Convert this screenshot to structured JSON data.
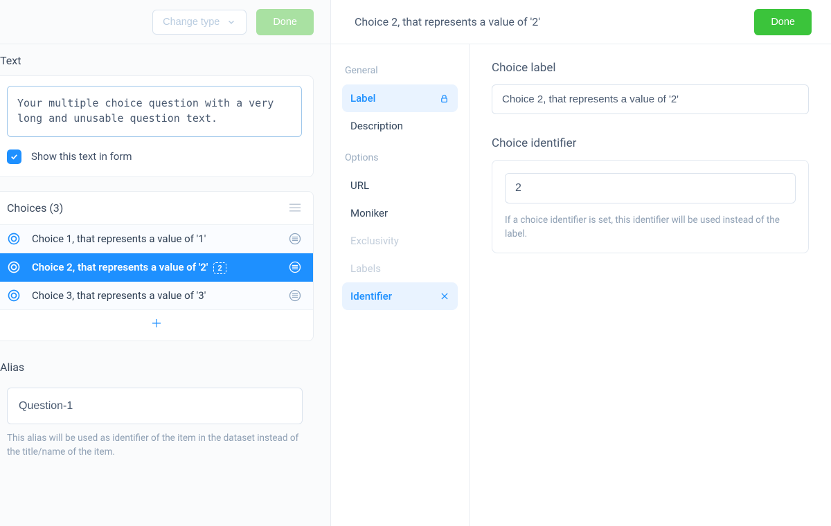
{
  "left": {
    "change_type_label": "Change type",
    "done_label": "Done",
    "text_section_title": "Text",
    "question_text": "Your multiple choice question with a very long and unusable question text.",
    "show_text_checkbox_label": "Show this text in form",
    "choices_title": "Choices (3)",
    "choices": [
      {
        "label": "Choice 1, that represents a value of '1'",
        "identifier": null,
        "selected": false
      },
      {
        "label": "Choice 2, that represents a value of '2'",
        "identifier": "2",
        "selected": true
      },
      {
        "label": "Choice 3, that represents a value of '3'",
        "identifier": null,
        "selected": false
      }
    ],
    "alias_section_title": "Alias",
    "alias_value": "Question-1",
    "alias_help": "This alias will be used as identifier of the item in the dataset instead of the title/name of the item."
  },
  "nav": {
    "group_general": "General",
    "group_options": "Options",
    "items_general": [
      {
        "key": "label",
        "label": "Label",
        "active": true,
        "disabled": false,
        "icon": "lock"
      },
      {
        "key": "description",
        "label": "Description",
        "active": false,
        "disabled": false,
        "icon": null
      }
    ],
    "items_options": [
      {
        "key": "url",
        "label": "URL",
        "active": false,
        "disabled": false,
        "icon": null
      },
      {
        "key": "moniker",
        "label": "Moniker",
        "active": false,
        "disabled": false,
        "icon": null
      },
      {
        "key": "exclusivity",
        "label": "Exclusivity",
        "active": false,
        "disabled": true,
        "icon": null
      },
      {
        "key": "labels",
        "label": "Labels",
        "active": false,
        "disabled": true,
        "icon": null
      },
      {
        "key": "identifier",
        "label": "Identifier",
        "active": true,
        "disabled": false,
        "icon": "close"
      }
    ]
  },
  "right": {
    "header_title": "Choice 2, that represents a value of '2'",
    "done_label": "Done",
    "choice_label_title": "Choice label",
    "choice_label_value": "Choice 2, that represents a value of '2'",
    "choice_identifier_title": "Choice identifier",
    "choice_identifier_value": "2",
    "choice_identifier_help": "If a choice identifier is set, this identifier will be used instead of the label."
  }
}
